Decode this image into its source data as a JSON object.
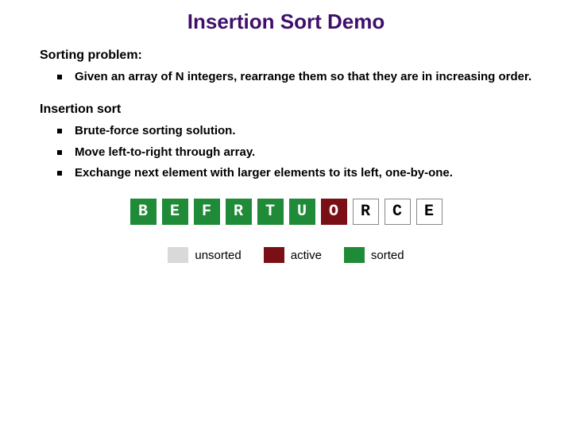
{
  "title": "Insertion Sort Demo",
  "section1": {
    "heading": "Sorting problem:",
    "bullets": [
      "Given an array of N integers, rearrange them so that they are in increasing order."
    ]
  },
  "section2": {
    "heading": "Insertion sort",
    "bullets": [
      "Brute-force sorting solution.",
      "Move left-to-right through array.",
      "Exchange next element with larger elements to its left, one-by-one."
    ]
  },
  "array": [
    {
      "letter": "B",
      "state": "sorted"
    },
    {
      "letter": "E",
      "state": "sorted"
    },
    {
      "letter": "F",
      "state": "sorted"
    },
    {
      "letter": "R",
      "state": "sorted"
    },
    {
      "letter": "T",
      "state": "sorted"
    },
    {
      "letter": "U",
      "state": "sorted"
    },
    {
      "letter": "O",
      "state": "active"
    },
    {
      "letter": "R",
      "state": "unsorted"
    },
    {
      "letter": "C",
      "state": "unsorted"
    },
    {
      "letter": "E",
      "state": "unsorted"
    }
  ],
  "legend": {
    "unsorted": "unsorted",
    "active": "active",
    "sorted": "sorted"
  }
}
